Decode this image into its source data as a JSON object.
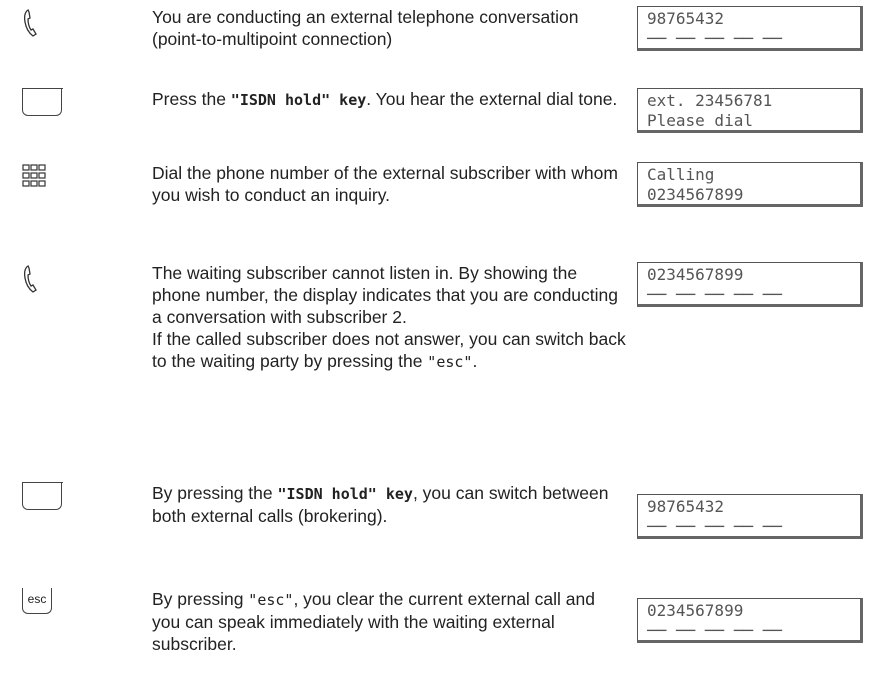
{
  "steps": [
    {
      "icon": "handset-icon",
      "text": [
        "You are conducting an external telephone conversation (point-to-multipoint connection)"
      ],
      "display": [
        "98765432",
        "── ── ── ── ──"
      ]
    },
    {
      "icon": "key-icon",
      "text_parts": {
        "pre": "Press the ",
        "key": "\"ISDN hold\" key",
        "post": ". You hear the external dial tone."
      },
      "display": [
        "ext. 23456781",
        "Please dial"
      ]
    },
    {
      "icon": "keypad-icon",
      "text": [
        "Dial the phone number of the external subscriber with whom you wish to conduct an inquiry."
      ],
      "display": [
        "Calling",
        "0234567899"
      ]
    },
    {
      "icon": "handset-icon",
      "text": [
        "The waiting subscriber cannot listen in. By showing the phone number, the display indicates that you are conducting a conversation with subscriber 2.",
        "If the called subscriber does not answer, you can switch back to the waiting party by pressing the "
      ],
      "text_esc": "\"esc\"",
      "text_end": ".",
      "display": [
        "0234567899",
        "── ── ── ── ──"
      ]
    },
    {
      "icon": "key-icon",
      "text_parts": {
        "pre": "By pressing the ",
        "key": "\"ISDN hold\" key",
        "post": ", you can switch between both external calls (brokering)."
      },
      "display": [
        "98765432",
        "── ── ── ── ──"
      ]
    },
    {
      "icon": "esc-key-icon",
      "esc_label": "esc",
      "text_parts": {
        "pre": "By pressing ",
        "key": "\"esc\"",
        "post": ", you clear the current external call and you can speak immediately with the waiting external subscriber."
      },
      "display": [
        "0234567899",
        "── ── ── ── ──"
      ]
    }
  ]
}
